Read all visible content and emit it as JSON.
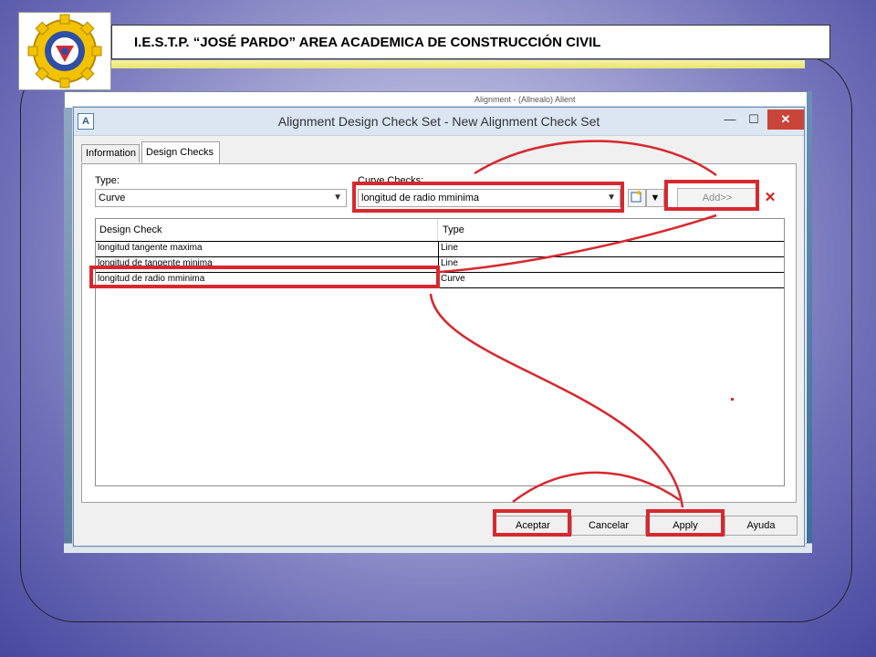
{
  "header": {
    "title": "I.E.S.T.P. “JOSÉ PARDO” AREA ACADEMICA DE CONSTRUCCIÓN CIVIL"
  },
  "cad": {
    "bg_text": "Alignment - (Allnealo) Allent"
  },
  "dialog": {
    "icon_letter": "A",
    "title": "Alignment Design Check Set - New Alignment Check Set",
    "minimize": "—",
    "maximize": "☐",
    "close": "✕",
    "tabs": [
      {
        "label": "Information"
      },
      {
        "label": "Design Checks"
      }
    ],
    "type_label": "Type:",
    "type_value": "Curve",
    "curve_checks_label": "Curve Checks:",
    "curve_checks_value": "longitud de radio mminima",
    "add_label": "Add>>",
    "delete_icon": "✕",
    "table": {
      "headers": [
        "Design Check",
        "Type"
      ],
      "rows": [
        {
          "check": "longitud tangente maxima",
          "type": "Line"
        },
        {
          "check": "longitud de tangente minima",
          "type": "Line"
        },
        {
          "check": "longitud de radio mminima",
          "type": "Curve"
        }
      ]
    },
    "buttons": {
      "ok": "Aceptar",
      "cancel": "Cancelar",
      "apply": "Apply",
      "help": "Ayuda"
    }
  },
  "colors": {
    "highlight": "#d8282f",
    "slide_bg": "#6f6fb8",
    "titlebar": "#dbe6f2"
  }
}
